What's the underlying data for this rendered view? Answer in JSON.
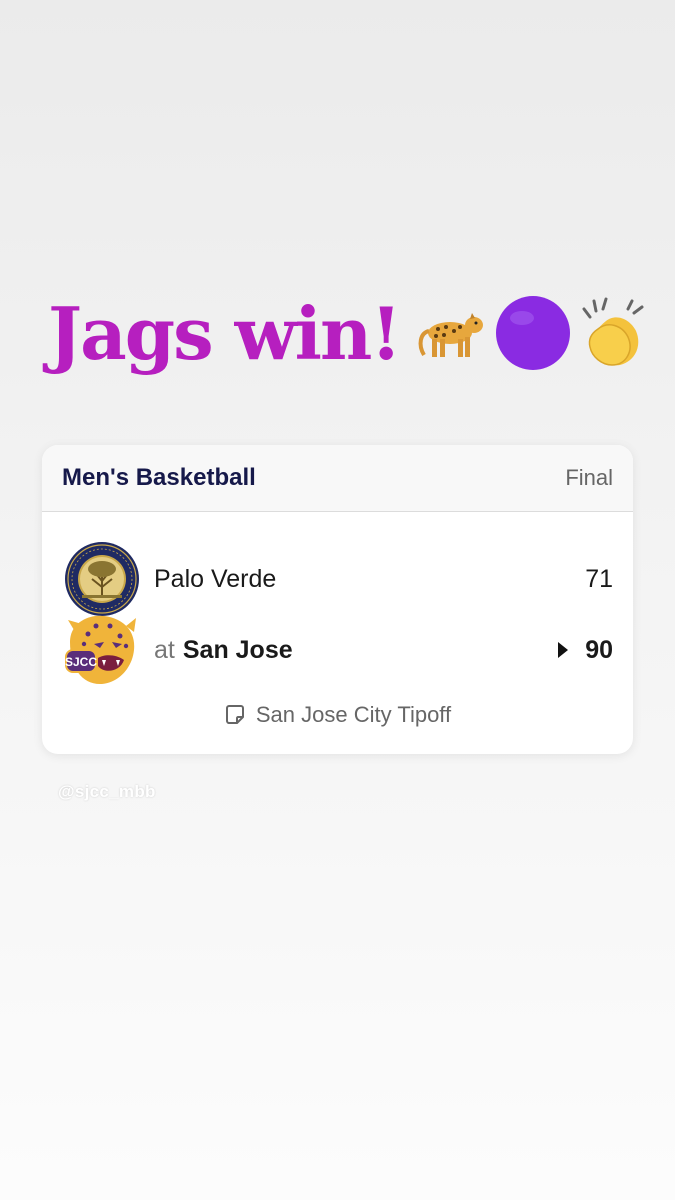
{
  "headline": {
    "text": "Jags win!",
    "emojis": [
      "leopard-emoji",
      "purple-circle-emoji",
      "clapping-hands-emoji"
    ]
  },
  "card": {
    "sport": "Men's Basketball",
    "status": "Final",
    "away": {
      "name": "Palo Verde",
      "score": "71",
      "logo": "palo-verde-college-seal"
    },
    "home": {
      "prefix": "at",
      "name": "San Jose",
      "score": "90",
      "logo": "sjcc-jaguar-logo",
      "winner": true
    },
    "event": "San Jose City Tipoff"
  },
  "handle": "@sjcc_mbb",
  "colors": {
    "headline": "#b61fbf",
    "sport_title": "#16194a",
    "purple_circle": "#8a2be2",
    "seal_navy": "#1f2a63",
    "seal_gold": "#c9a84a"
  }
}
